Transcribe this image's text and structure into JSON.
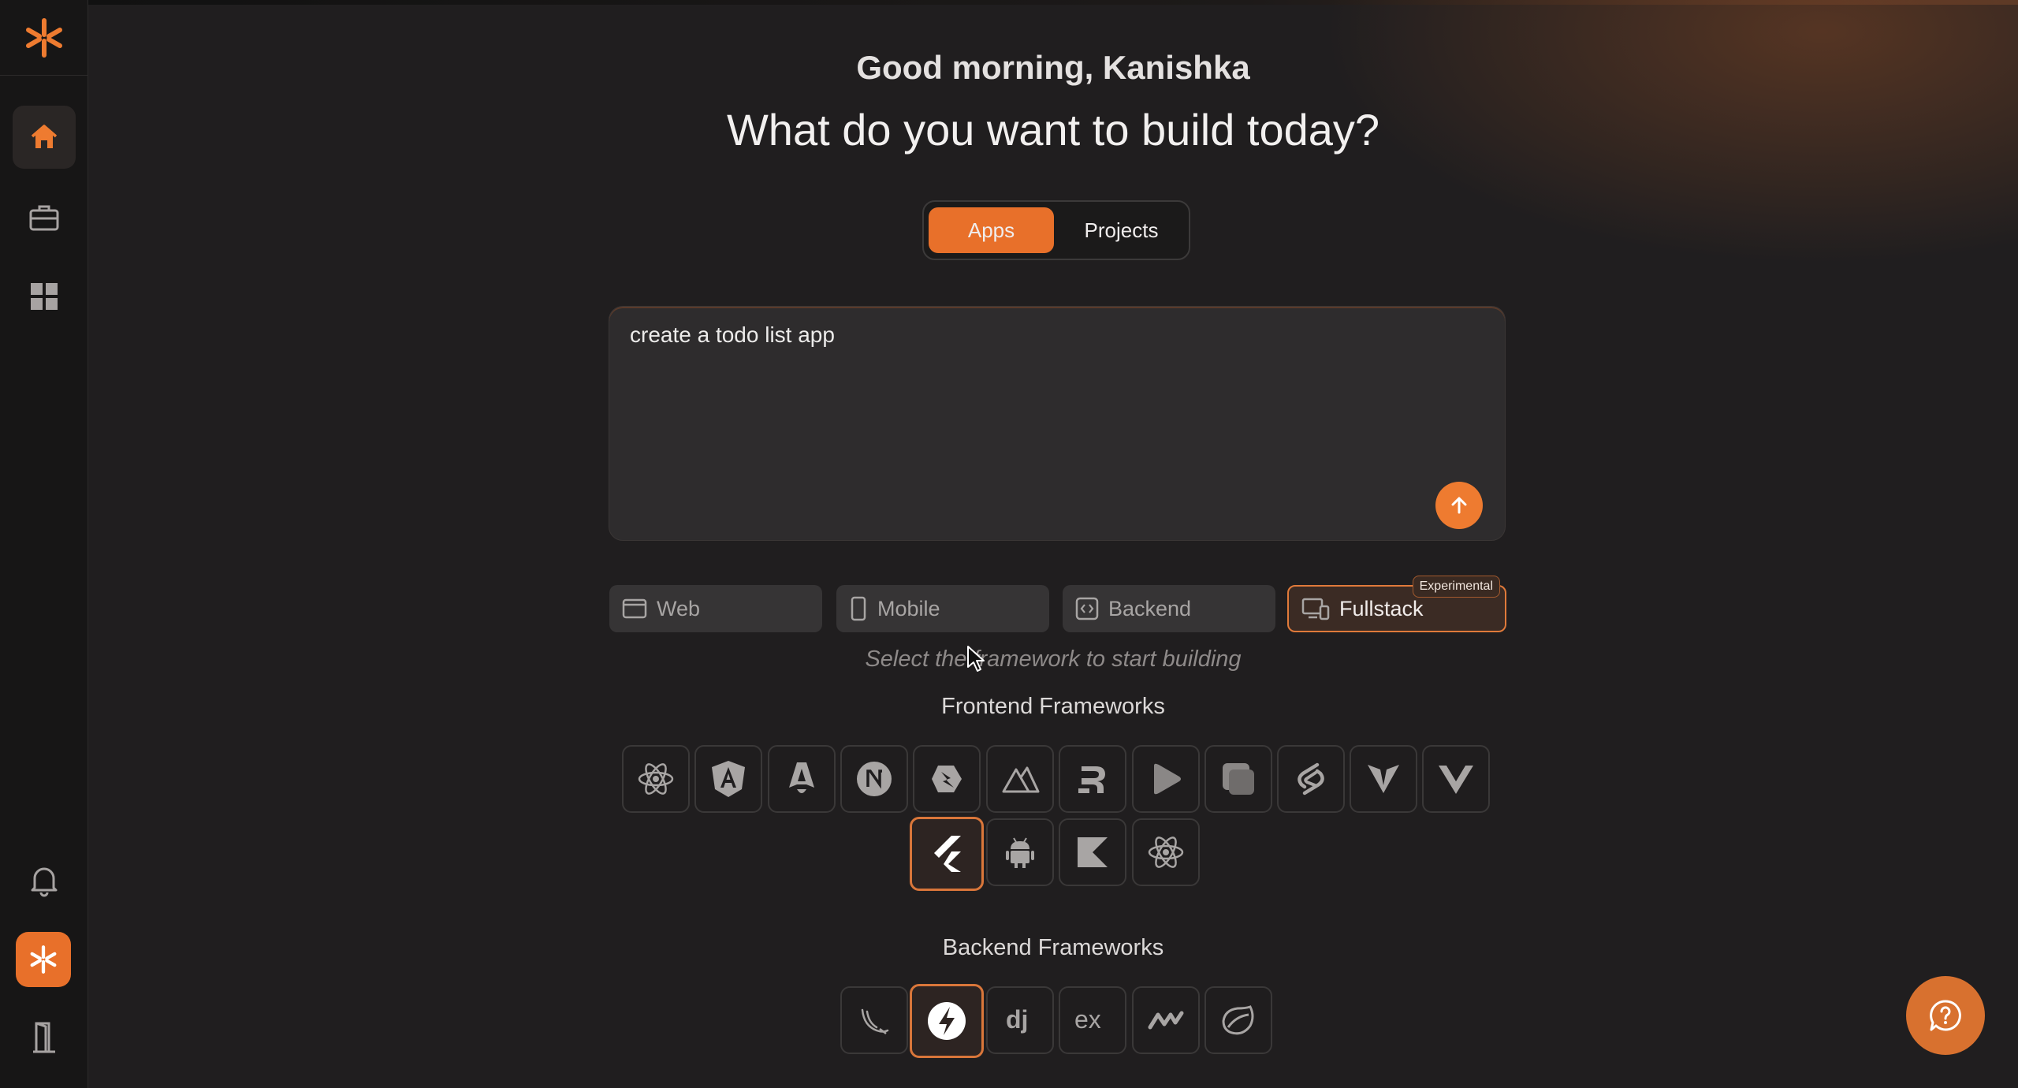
{
  "sidebar": {
    "items": [
      {
        "name": "home",
        "icon": "home-icon",
        "active": true
      },
      {
        "name": "projects",
        "icon": "briefcase-icon"
      },
      {
        "name": "apps",
        "icon": "grid-icon"
      }
    ],
    "bottom": [
      {
        "name": "notifications",
        "icon": "bell-icon"
      },
      {
        "name": "brand",
        "icon": "asterisk-icon"
      },
      {
        "name": "logout",
        "icon": "door-icon"
      }
    ]
  },
  "header": {
    "greeting": "Good morning, Kanishka",
    "headline": "What do you want to build today?"
  },
  "mode_toggle": {
    "options": [
      "Apps",
      "Projects"
    ],
    "selected": "Apps"
  },
  "prompt": {
    "value": "create a todo list app",
    "placeholder": ""
  },
  "app_types": [
    {
      "label": "Web",
      "icon": "browser-icon"
    },
    {
      "label": "Mobile",
      "icon": "phone-icon"
    },
    {
      "label": "Backend",
      "icon": "code-icon"
    },
    {
      "label": "Fullstack",
      "icon": "devices-icon",
      "selected": true,
      "badge": "Experimental"
    }
  ],
  "hint": "Select the framework to start building",
  "frontend": {
    "title": "Frontend Frameworks",
    "items": [
      "react-icon",
      "angular-icon",
      "astro-icon",
      "nextjs-icon",
      "qwik-icon",
      "nuxt-icon",
      "remix-icon",
      "solidstart-icon",
      "solid-icon",
      "svelte-icon",
      "vite-icon",
      "vue-icon",
      "flutter-icon",
      "android-icon",
      "kotlin-icon",
      "react-native-icon"
    ],
    "selected": "flutter-icon"
  },
  "backend": {
    "title": "Backend Frameworks",
    "items": [
      "flask-icon",
      "fastapi-icon",
      "django-icon",
      "express-icon",
      "nestjs-icon",
      "spring-icon"
    ],
    "selected": "fastapi-icon"
  },
  "colors": {
    "accent": "#e8702a",
    "background": "#201e1f",
    "sidebar": "#171616"
  }
}
